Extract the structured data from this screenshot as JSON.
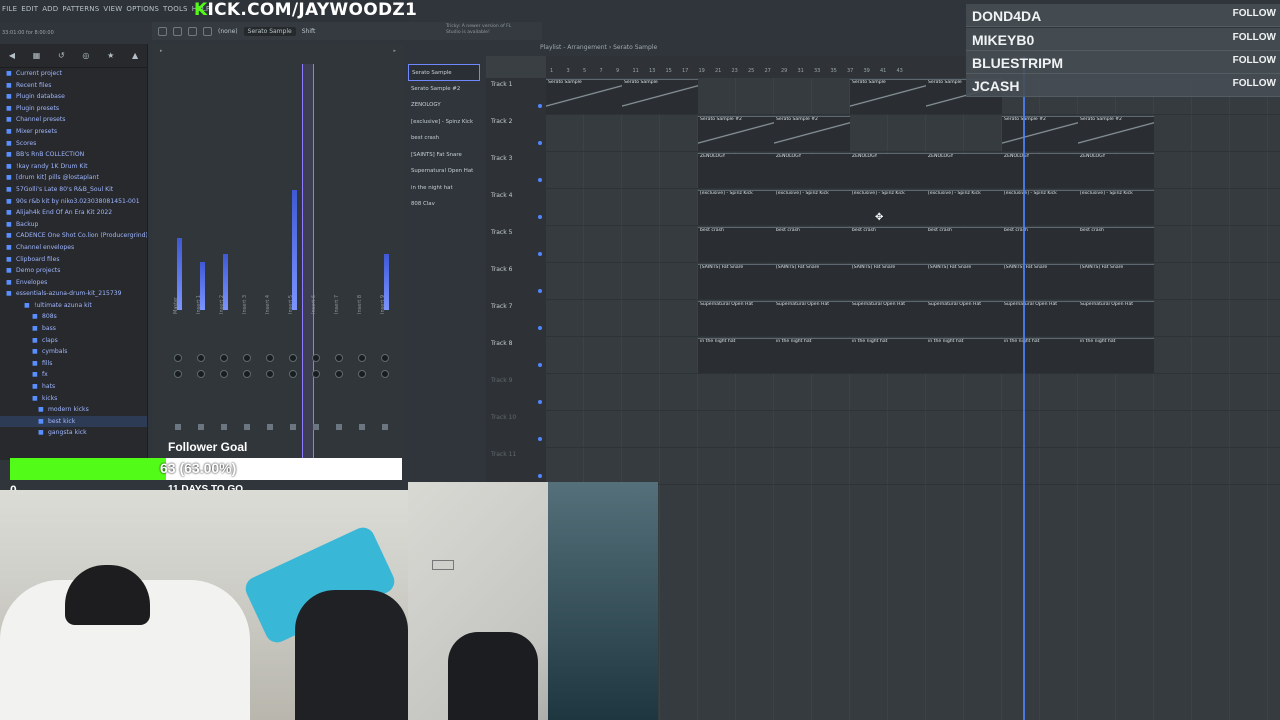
{
  "menu": {
    "items": [
      "FILE",
      "EDIT",
      "ADD",
      "PATTERNS",
      "VIEW",
      "OPTIONS",
      "TOOLS",
      "HELP"
    ],
    "time_display": "33:01:00 for 8:00:00",
    "hint_lines": [
      "Default1",
      "33:01:00 for 8:00:00"
    ]
  },
  "banner": {
    "prefix": "K",
    "text": "ICK.COM/JAYWOODZ1"
  },
  "toolbar": {
    "pattern": "Serato Sample",
    "mode": "(none)",
    "shift_label": "Shift",
    "update_notice": "Tricky: A newer version of FL Studio is available!"
  },
  "browser": {
    "items": [
      {
        "label": "Current project",
        "level": 0
      },
      {
        "label": "Recent files",
        "level": 0
      },
      {
        "label": "Plugin database",
        "level": 0
      },
      {
        "label": "Plugin presets",
        "level": 0
      },
      {
        "label": "Channel presets",
        "level": 0
      },
      {
        "label": "Mixer presets",
        "level": 0
      },
      {
        "label": "Scores",
        "level": 0
      },
      {
        "label": "BB's RnB COLLECTION",
        "level": 0
      },
      {
        "label": "!kay randy 1K Drum Kit",
        "level": 0
      },
      {
        "label": "[drum kit] pills @lostaplant",
        "level": 0
      },
      {
        "label": "57Golli's Late 80's R&B_Soul Kit",
        "level": 0
      },
      {
        "label": "90s r&b kit by niko3.023038081451-001",
        "level": 0
      },
      {
        "label": "Alijah4k End Of An Era Kit 2022",
        "level": 0
      },
      {
        "label": "Backup",
        "level": 0
      },
      {
        "label": "CADENCE One Shot Co.lion (Producergrind)",
        "level": 0
      },
      {
        "label": "Channel envelopes",
        "level": 0
      },
      {
        "label": "Clipboard files",
        "level": 0
      },
      {
        "label": "Demo projects",
        "level": 0
      },
      {
        "label": "Envelopes",
        "level": 0
      },
      {
        "label": "essentials-azuna-drum-kit_215739",
        "level": 0
      },
      {
        "label": "!ultimate azuna kit",
        "level": 1
      },
      {
        "label": "808s",
        "level": 2
      },
      {
        "label": "bass",
        "level": 2
      },
      {
        "label": "claps",
        "level": 2
      },
      {
        "label": "cymbals",
        "level": 2
      },
      {
        "label": "fills",
        "level": 2
      },
      {
        "label": "fx",
        "level": 2
      },
      {
        "label": "hats",
        "level": 2
      },
      {
        "label": "kicks",
        "level": 2
      },
      {
        "label": "modern kicks",
        "level": 3
      },
      {
        "label": "best kick",
        "level": 3
      },
      {
        "label": "gangsta kick",
        "level": 3
      }
    ]
  },
  "mixer": {
    "tracks": [
      "Master",
      "Insert 1",
      "Insert 2",
      "Insert 3",
      "Insert 4",
      "Insert 5",
      "Insert 6",
      "Insert 7",
      "Insert 8",
      "Insert 9"
    ],
    "levels": [
      0.45,
      0.3,
      0.35,
      0,
      0,
      0.75,
      0,
      0,
      0,
      0.35
    ]
  },
  "channels": [
    "Serato Sample",
    "Serato Sample #2",
    "ZENOLOGY",
    "[exclusive] - Spinz Kick",
    "best crash",
    "[SAINTS] Fat Snare",
    "Supernatural Open Hat",
    "in the night hat",
    "808 Clav"
  ],
  "playlist": {
    "title": "Playlist - Arrangement › Serato Sample",
    "ruler": [
      "1",
      "3",
      "5",
      "7",
      "9",
      "11",
      "13",
      "15",
      "17",
      "19",
      "21",
      "23",
      "25",
      "27",
      "29",
      "31",
      "33",
      "35",
      "37",
      "39",
      "41",
      "43"
    ],
    "tracks": [
      {
        "name": "Track 1",
        "clips": [
          "Serato Sample",
          "Serato Sample",
          "Serato Sample",
          "Serato Sample"
        ]
      },
      {
        "name": "Track 2",
        "clips": [
          "Serato Sample #2",
          "Serato Sample #2",
          "Serato Sample #2",
          "Serato Sample #2"
        ]
      },
      {
        "name": "Track 3",
        "clips": [
          "ZENOLOGY",
          "ZENOLOGY",
          "ZENOLOGY",
          "ZENOLOGY",
          "ZENOLOGY",
          "ZENOLOGY"
        ]
      },
      {
        "name": "Track 4",
        "clips": [
          "[exclusive] - Spinz Kick",
          "[exclusive] - Spinz Kick",
          "[exclusive] - Spinz Kick",
          "[exclusive] - Spinz Kick",
          "[exclusive] - Spinz Kick",
          "[exclusive] - Spinz Kick"
        ]
      },
      {
        "name": "Track 5",
        "clips": [
          "best crash",
          "best crash",
          "best crash",
          "best crash",
          "best crash",
          "best crash"
        ]
      },
      {
        "name": "Track 6",
        "clips": [
          "[SAINTS] Fat Snare",
          "[SAINTS] Fat Snare",
          "[SAINTS] Fat Snare",
          "[SAINTS] Fat Snare",
          "[SAINTS] Fat Snare",
          "[SAINTS] Fat Snare"
        ]
      },
      {
        "name": "Track 7",
        "clips": [
          "Supernatural Open Hat",
          "Supernatural Open Hat",
          "Supernatural Open Hat",
          "Supernatural Open Hat",
          "Supernatural Open Hat",
          "Supernatural Open Hat"
        ]
      },
      {
        "name": "Track 8",
        "clips": [
          "in the night hat",
          "in the night hat",
          "in the night hat",
          "in the night hat",
          "in the night hat",
          "in the night hat"
        ]
      },
      {
        "name": "Track 9",
        "clips": []
      },
      {
        "name": "Track 10",
        "clips": []
      },
      {
        "name": "Track 11",
        "clips": []
      }
    ]
  },
  "followers": [
    {
      "name": "DOND4DA",
      "action": "FOLLOW"
    },
    {
      "name": "MIKEYB0",
      "action": "FOLLOW"
    },
    {
      "name": "BLUESTRIPM",
      "action": "FOLLOW"
    },
    {
      "name": "JCASH",
      "action": "FOLLOW"
    }
  ],
  "goal": {
    "title": "Follower Goal",
    "progress_text": "63 (63.00%)",
    "progress": 0.63,
    "start": "0",
    "days_left": "11 DAYS TO GO"
  },
  "colors": {
    "kick_green": "#53fc18",
    "accent": "#4c84ff"
  }
}
